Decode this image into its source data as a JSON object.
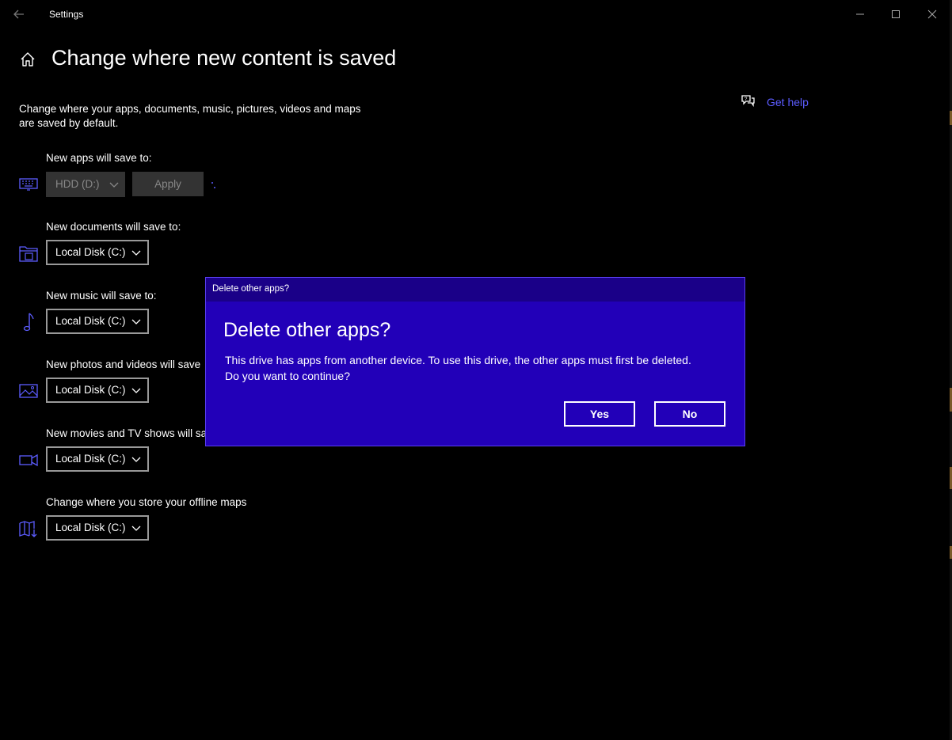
{
  "window": {
    "app_title": "Settings",
    "back_icon": "arrow-left-icon",
    "minimize_icon": "minimize-icon",
    "maximize_icon": "maximize-icon",
    "close_icon": "close-icon"
  },
  "header": {
    "home_icon": "home-icon",
    "page_title": "Change where new content is saved"
  },
  "help": {
    "icon": "chat-help-icon",
    "label": "Get help"
  },
  "description": "Change where your apps, documents, music, pictures, videos and maps are saved by default.",
  "settings": [
    {
      "label": "New apps will save to:",
      "icon": "keyboard-icon",
      "value": "HDD (D:)",
      "disabled": true
    },
    {
      "label": "New documents will save to:",
      "icon": "folder-documents-icon",
      "value": "Local Disk (C:)"
    },
    {
      "label": "New music will save to:",
      "icon": "music-note-icon",
      "value": "Local Disk (C:)"
    },
    {
      "label": "New photos and videos will save",
      "icon": "photo-icon",
      "value": "Local Disk (C:)"
    },
    {
      "label": "New movies and TV shows will sa",
      "icon": "video-camera-icon",
      "value": "Local Disk (C:)"
    },
    {
      "label": "Change where you store your offline maps",
      "icon": "map-download-icon",
      "value": "Local Disk (C:)"
    }
  ],
  "apply_button": "Apply",
  "dialog": {
    "title_bar": "Delete other apps?",
    "heading": "Delete other apps?",
    "body_line1": "This drive has apps from another device. To use this drive, the other apps must first be deleted.",
    "body_line2": "Do you want to continue?",
    "yes_label": "Yes",
    "no_label": "No"
  },
  "colors": {
    "accent": "#5c5cff",
    "dialog_bg": "#2200b8",
    "dialog_titlebar": "#1a0088",
    "background": "#000000"
  }
}
